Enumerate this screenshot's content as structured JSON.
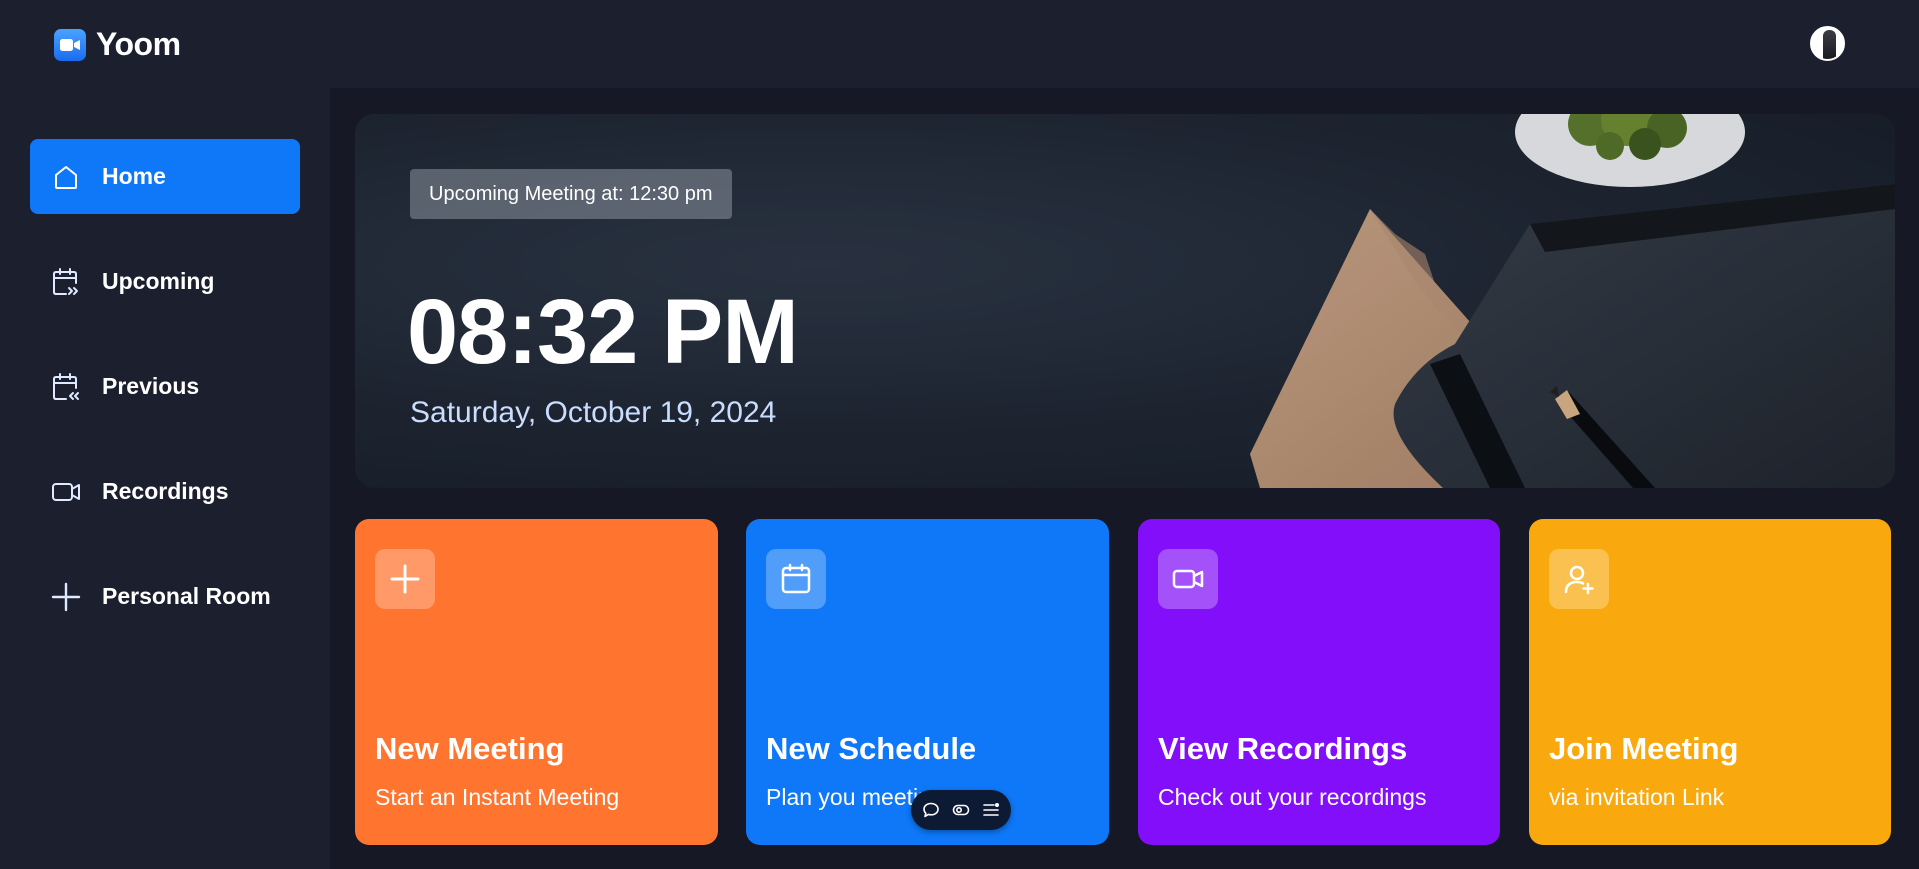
{
  "app": {
    "name": "Yoom",
    "logo_icon": "video-camera-icon",
    "brand_color": "#0e78f9"
  },
  "header": {
    "avatar_icon": "user-avatar"
  },
  "sidebar": {
    "items": [
      {
        "label": "Home",
        "icon": "home-icon",
        "active": true
      },
      {
        "label": "Upcoming",
        "icon": "calendar-forward-icon",
        "active": false
      },
      {
        "label": "Previous",
        "icon": "calendar-back-icon",
        "active": false
      },
      {
        "label": "Recordings",
        "icon": "video-icon",
        "active": false
      },
      {
        "label": "Personal Room",
        "icon": "plus-icon",
        "active": false
      }
    ]
  },
  "hero": {
    "upcoming_label": "Upcoming Meeting at: 12:30 pm",
    "time": "08:32 PM",
    "date": "Saturday, October 19, 2024"
  },
  "cards": [
    {
      "title": "New Meeting",
      "subtitle": "Start an Instant Meeting",
      "icon": "plus-icon",
      "color": "#ff742e"
    },
    {
      "title": "New Schedule",
      "subtitle": "Plan you meeting",
      "icon": "calendar-icon",
      "color": "#0e78f9"
    },
    {
      "title": "View Recordings",
      "subtitle": "Check out your recordings",
      "icon": "video-icon",
      "color": "#830ef9"
    },
    {
      "title": "Join Meeting",
      "subtitle": "via invitation Link",
      "icon": "user-plus-icon",
      "color": "#f9a90e"
    }
  ],
  "floating_toolbar": {
    "buttons": [
      "comment-icon",
      "toggle-icon",
      "list-icon"
    ]
  }
}
